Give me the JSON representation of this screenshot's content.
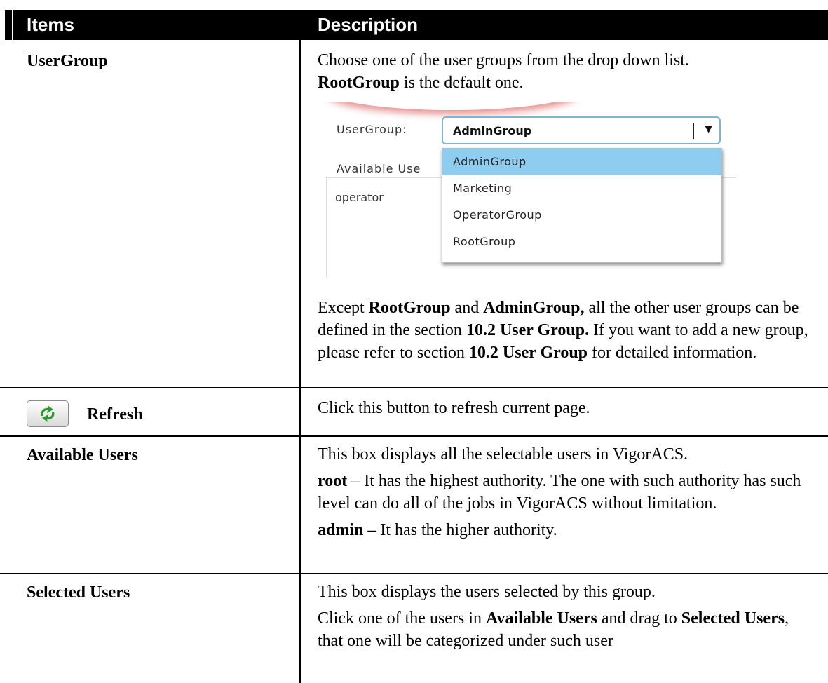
{
  "table": {
    "header": {
      "items": "Items",
      "description": "Description"
    },
    "rows": [
      {
        "item": "UserGroup",
        "desc_intro_1": "Choose one of the user groups from the drop down list.",
        "desc_intro_bold": "RootGroup",
        "desc_intro_2": " is the default one.",
        "screenshot": {
          "usergroup_label": "UserGroup:",
          "selected_value": "AdminGroup",
          "available_label": "Available Use",
          "user_in_box": "operator",
          "options": [
            "AdminGroup",
            "Marketing",
            "OperatorGroup",
            "RootGroup"
          ]
        },
        "note": {
          "t1": "Except ",
          "b1": "RootGroup",
          "t2": " and ",
          "b2": "AdminGroup,",
          "t3": " all the other user groups can be defined in the section ",
          "b3": "10.2 User Group.",
          "t4": " If you want to add a new group, please refer to section ",
          "b4": "10.2 User Group",
          "t5": " for detailed information."
        }
      },
      {
        "item": "Refresh",
        "desc": "Click this button to refresh current page."
      },
      {
        "item": "Available Users",
        "desc_1": "This box displays all the selectable users in VigorACS.",
        "root_bold": "root",
        "root_text": " – It has the highest authority. The one with such authority has such level can do all of the jobs in VigorACS without limitation.",
        "admin_bold": "admin",
        "admin_text": " – It has the higher authority."
      },
      {
        "item": "Selected Users",
        "desc_1": "This box displays the users selected by this group.",
        "t1": "Click one of the users in ",
        "b1": "Available Users",
        "t2": " and drag to ",
        "b2": "Selected Users",
        "t3": ", that one will be categorized under such user"
      }
    ]
  },
  "icons": {
    "refresh": "refresh-arrows-icon",
    "dropdown": "chevron-down-icon"
  },
  "colors": {
    "header_bg": "#000000",
    "header_text": "#ffffff",
    "selected_option": "#8fcdf0",
    "select_border": "#7db5d8",
    "refresh_icon": "#2e9a2e"
  }
}
